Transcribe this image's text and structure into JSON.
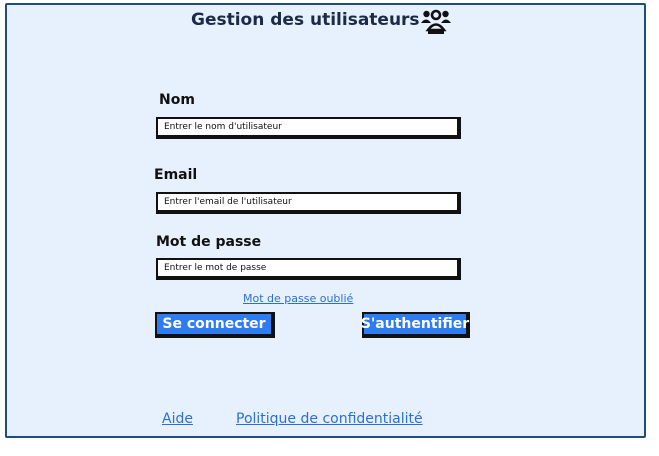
{
  "header": {
    "title": "Gestion des utilisateurs",
    "icon": "users-group-icon"
  },
  "form": {
    "name": {
      "label": "Nom",
      "placeholder": "Entrer le nom d'utilisateur"
    },
    "email": {
      "label": "Email",
      "placeholder": "Entrer l'email de l'utilisateur"
    },
    "password": {
      "label": "Mot de passe",
      "placeholder": "Entrer le mot de passe"
    },
    "forgot_link": "Mot de passe oublié",
    "login_button": "Se connecter",
    "auth_button": "S'authentifier"
  },
  "footer": {
    "help": "Aide",
    "privacy": "Politique de confidentialité"
  },
  "colors": {
    "background": "#e7f1fd",
    "border": "#1f4d78",
    "accent": "#2f7cf0",
    "link": "#2b6fd6"
  }
}
